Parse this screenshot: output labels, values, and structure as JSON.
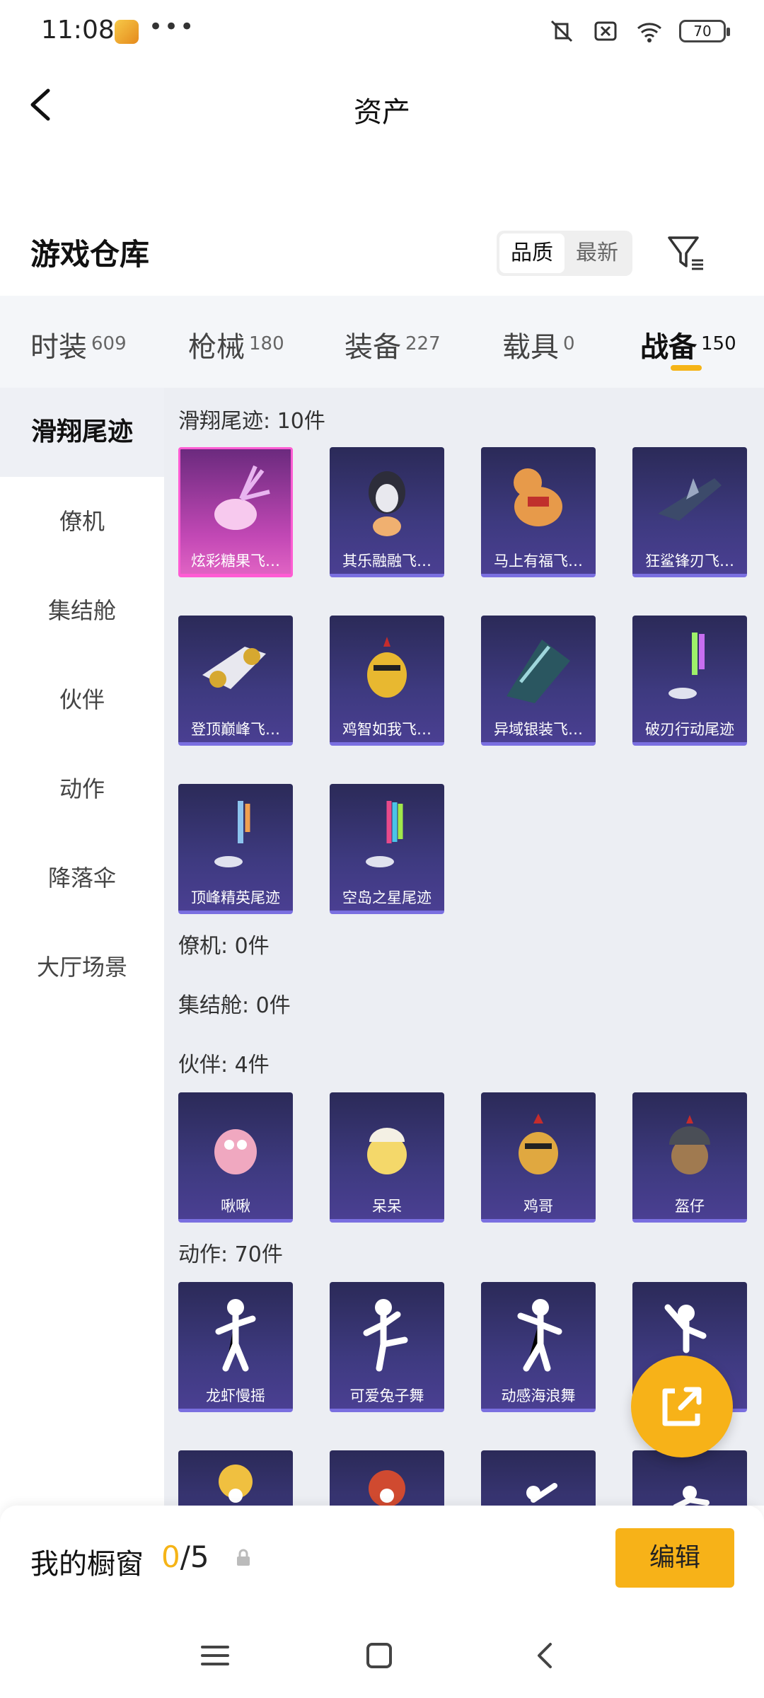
{
  "status_bar": {
    "time": "11:08",
    "dots": "•••",
    "battery": "70"
  },
  "header": {
    "title": "资产"
  },
  "warehouse": {
    "title": "游戏仓库",
    "sort_options": [
      "品质",
      "最新"
    ],
    "active_sort": "品质"
  },
  "tabs": [
    {
      "label": "时装",
      "count": "609"
    },
    {
      "label": "枪械",
      "count": "180"
    },
    {
      "label": "装备",
      "count": "227"
    },
    {
      "label": "载具",
      "count": "0"
    },
    {
      "label": "战备",
      "count": "150"
    }
  ],
  "active_tab": "战备",
  "sidebar": {
    "items": [
      "滑翔尾迹",
      "僚机",
      "集结舱",
      "伙伴",
      "动作",
      "降落伞",
      "大厅场景"
    ],
    "active": "滑翔尾迹"
  },
  "sections": {
    "glide": {
      "title": "滑翔尾迹: 10件",
      "items": [
        "炫彩糖果飞…",
        "其乐融融飞…",
        "马上有福飞…",
        "狂鲨锋刃飞…",
        "登顶巅峰飞…",
        "鸡智如我飞…",
        "异域银装飞…",
        "破刃行动尾迹",
        "顶峰精英尾迹",
        "空岛之星尾迹"
      ]
    },
    "wingman": {
      "title": "僚机: 0件"
    },
    "capsule": {
      "title": "集结舱: 0件"
    },
    "partner": {
      "title": "伙伴: 4件",
      "items": [
        "啾啾",
        "呆呆",
        "鸡哥",
        "盔仔"
      ]
    },
    "emote": {
      "title": "动作: 70件",
      "items": [
        "龙虾慢摇",
        "可爱兔子舞",
        "动感海浪舞"
      ]
    }
  },
  "showcase": {
    "label": "我的橱窗",
    "current": "0",
    "total": "/5",
    "edit_label": "编辑"
  },
  "colors": {
    "accent": "#f7b218",
    "card_bg": "#3e3a80",
    "card_highlight": "#e063c3"
  }
}
